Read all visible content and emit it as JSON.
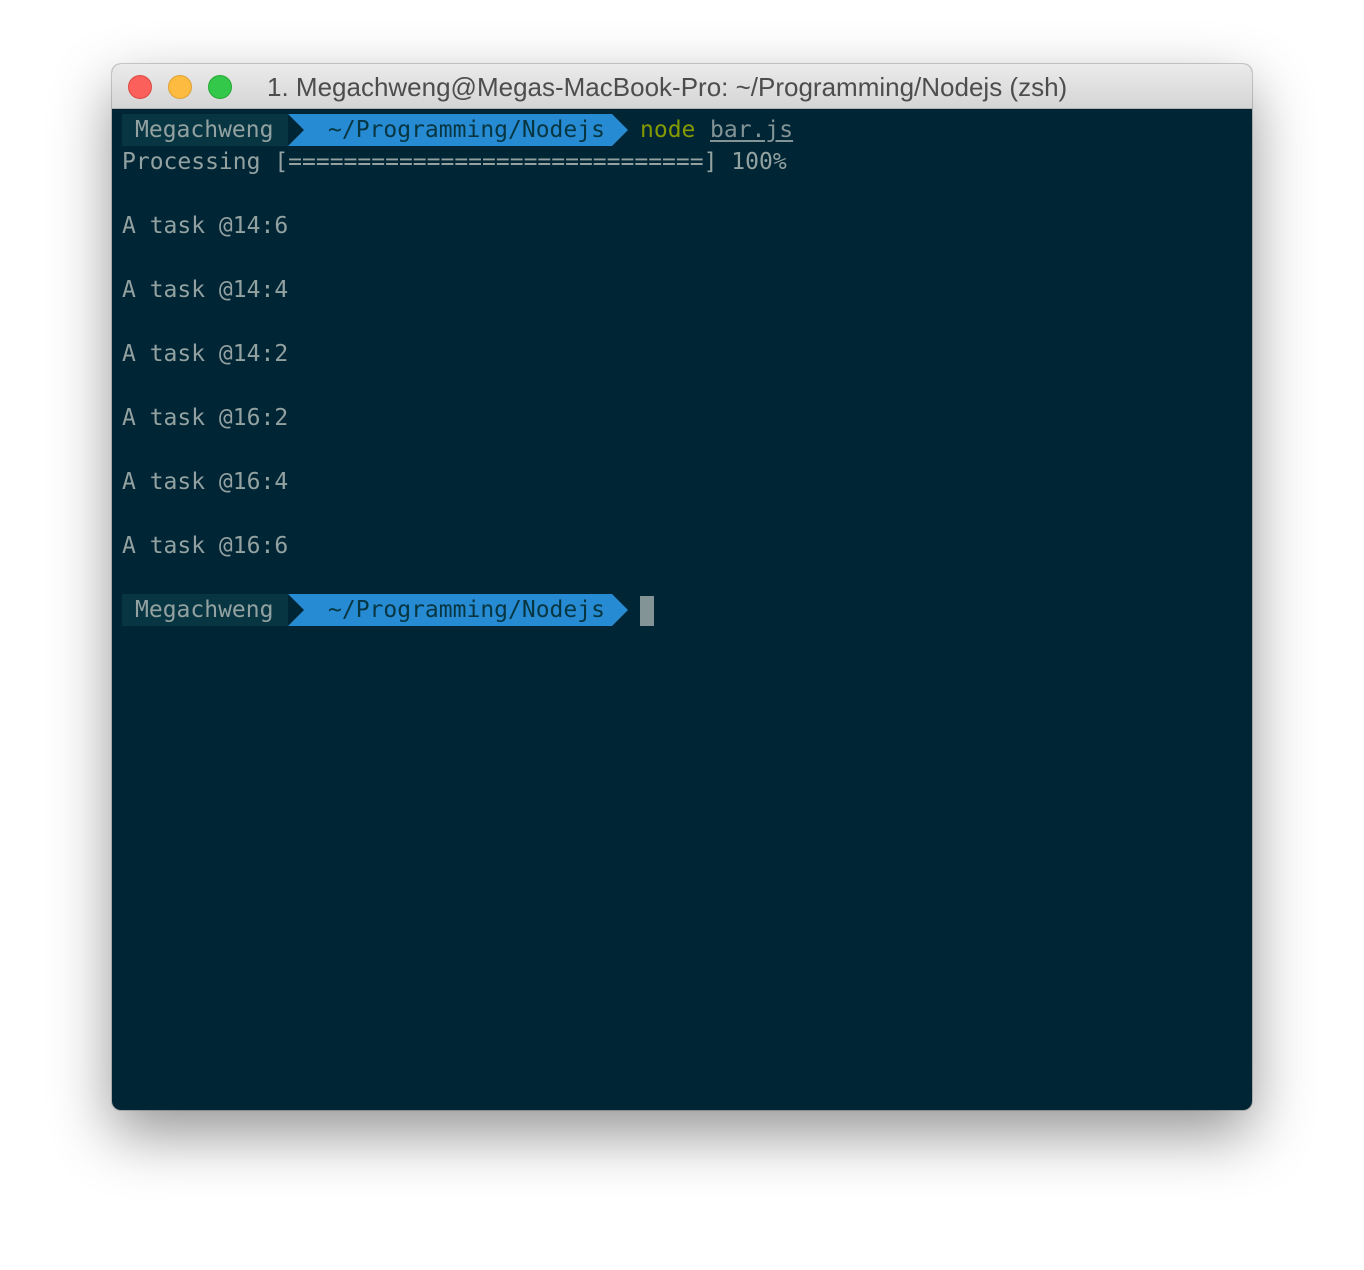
{
  "window": {
    "title": "1. Megachweng@Megas-MacBook-Pro: ~/Programming/Nodejs (zsh)",
    "background_color": "#002635"
  },
  "prompt": {
    "user": "Megachweng",
    "path": "~/Programming/Nodejs",
    "user_bg": "#073642",
    "path_bg": "#268bd2"
  },
  "session": {
    "command": "node",
    "argument": "bar.js",
    "progress_line": "Processing [==============================] 100%",
    "progress_percent": 100,
    "output_lines": [
      "A task @14:6",
      "A task @14:4",
      "A task @14:2",
      "A task @16:2",
      "A task @16:4",
      "A task @16:6"
    ]
  }
}
